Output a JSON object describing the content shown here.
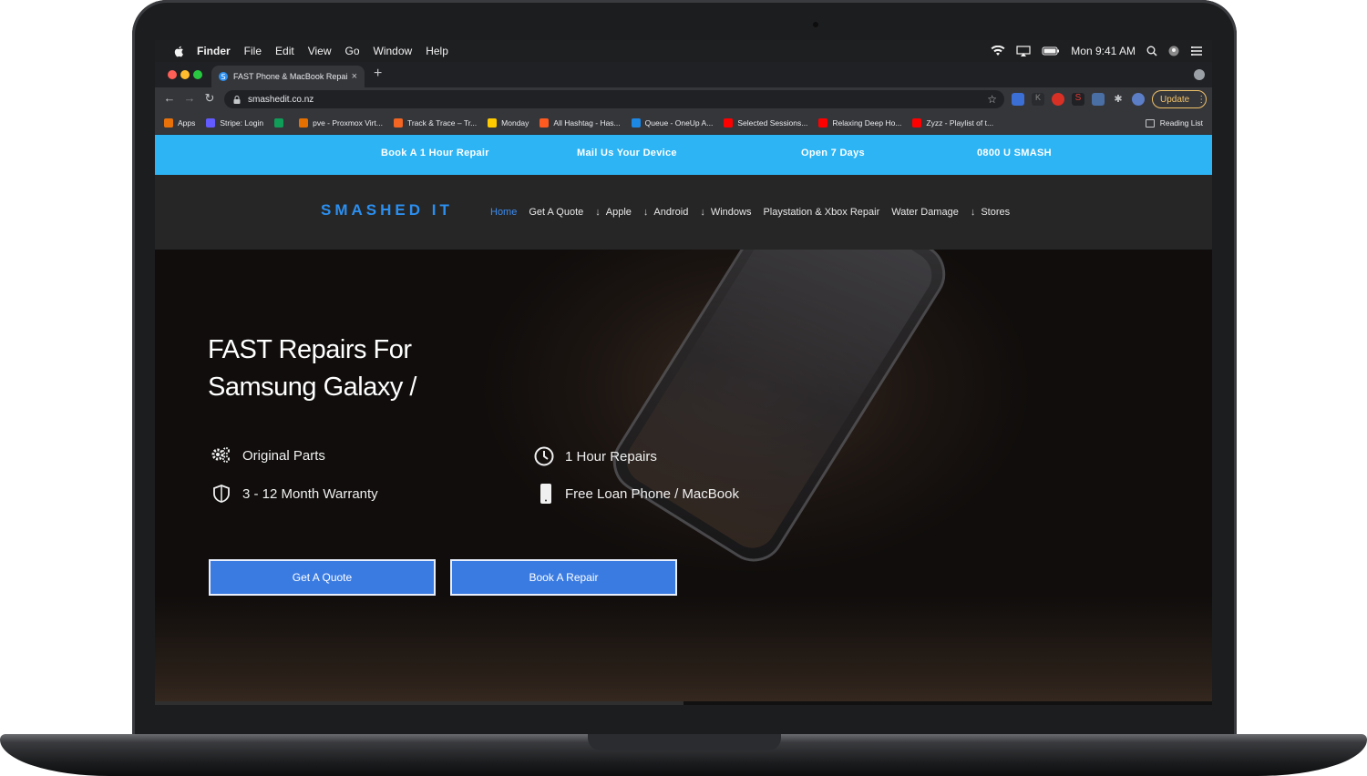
{
  "menubar": {
    "items": [
      "Finder",
      "File",
      "Edit",
      "View",
      "Go",
      "Window",
      "Help"
    ],
    "clock": "Mon 9:41 AM"
  },
  "browser": {
    "tab_title": "FAST Phone & MacBook Repai",
    "tab_close": "×",
    "new_tab": "+",
    "url": "smashedit.co.nz",
    "update_label": "Update",
    "update_menu": "⋮",
    "bookmarks": [
      {
        "label": "Apps",
        "icon": "apps-grid-icon",
        "color": "#e8710a"
      },
      {
        "label": "Stripe: Login",
        "icon": "stripe-icon",
        "color": "#635bff"
      },
      {
        "label": "",
        "icon": "sheets-icon",
        "color": "#0f9d58"
      },
      {
        "label": "pve - Proxmox Virt...",
        "icon": "proxmox-icon",
        "color": "#e57000"
      },
      {
        "label": "Track & Trace – Tr...",
        "icon": "track-icon",
        "color": "#f26522"
      },
      {
        "label": "Monday",
        "icon": "monday-icon",
        "color": "#ffcb00"
      },
      {
        "label": "All Hashtag - Has...",
        "icon": "hashtag-icon",
        "color": "#ff5a1f"
      },
      {
        "label": "Queue - OneUp A...",
        "icon": "oneup-icon",
        "color": "#1e88e5"
      },
      {
        "label": "Selected Sessions...",
        "icon": "youtube-icon",
        "color": "#ff0000"
      },
      {
        "label": "Relaxing Deep Ho...",
        "icon": "youtube-icon",
        "color": "#ff0000"
      },
      {
        "label": "Zyzz - Playlist of t...",
        "icon": "youtube-icon",
        "color": "#ff0000"
      }
    ],
    "reading_list": "Reading List"
  },
  "site": {
    "topbar": [
      "Book A 1 Hour Repair",
      "Mail Us Your Device",
      "Open 7 Days",
      "0800 U SMASH"
    ],
    "logo": "SMASHED IT",
    "nav": [
      {
        "label": "Home",
        "arrow": false,
        "active": true
      },
      {
        "label": "Get A Quote",
        "arrow": false
      },
      {
        "label": "Apple",
        "arrow": true
      },
      {
        "label": "Android",
        "arrow": true
      },
      {
        "label": "Windows",
        "arrow": true
      },
      {
        "label": "Playstation & Xbox Repair",
        "arrow": false
      },
      {
        "label": "Water Damage",
        "arrow": false
      },
      {
        "label": "Stores",
        "arrow": true
      }
    ],
    "hero": {
      "title_line1": "FAST Repairs For",
      "title_line2": "Samsung Galaxy /",
      "features": {
        "original_parts": "Original Parts",
        "warranty": "3 - 12 Month Warranty",
        "hour_repairs": "1 Hour Repairs",
        "loan_phone": "Free Loan Phone / MacBook"
      },
      "quote_button": "Get A Quote",
      "book_button": "Book A Repair",
      "slider_progress": 0.5
    },
    "colors": {
      "topbar": "#2db4f4",
      "accent": "#3a7be2",
      "logo": "#2b8ff0",
      "header": "#262626"
    }
  }
}
